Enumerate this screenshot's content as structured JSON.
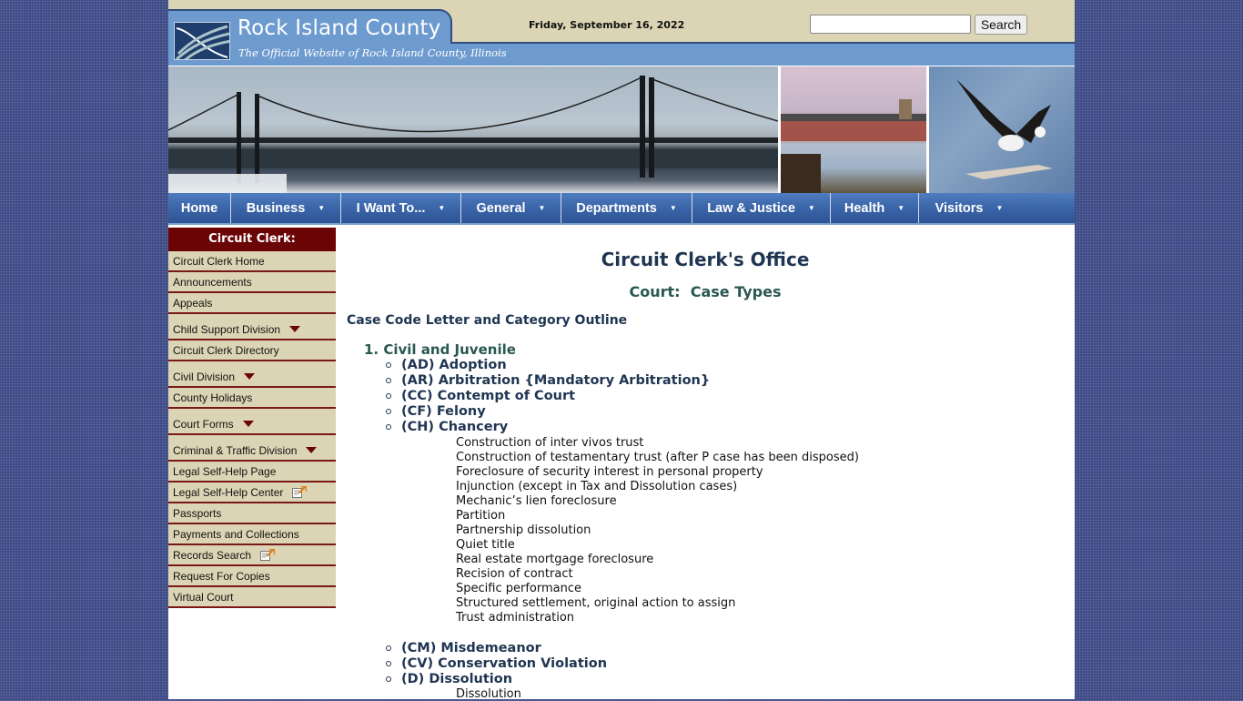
{
  "header": {
    "site_title": "Rock Island County",
    "site_subtitle": "The Official Website of Rock Island County, Illinois",
    "date": "Friday, September 16, 2022",
    "search": {
      "placeholder": "",
      "value": "",
      "button_label": "Search"
    }
  },
  "banner": {
    "images": [
      "bridge-photo",
      "lock-and-dam-photo",
      "bald-eagle-photo"
    ]
  },
  "nav": {
    "items": [
      {
        "label": "Home",
        "has_dropdown": false
      },
      {
        "label": "Business",
        "has_dropdown": true
      },
      {
        "label": "I Want To...",
        "has_dropdown": true
      },
      {
        "label": "General",
        "has_dropdown": true
      },
      {
        "label": "Departments",
        "has_dropdown": true
      },
      {
        "label": "Law & Justice",
        "has_dropdown": true
      },
      {
        "label": "Health",
        "has_dropdown": true
      },
      {
        "label": "Visitors",
        "has_dropdown": true
      }
    ]
  },
  "sidebar": {
    "heading": "Circuit Clerk:",
    "items": [
      {
        "label": "Circuit Clerk Home",
        "icon": ""
      },
      {
        "label": "Announcements",
        "icon": ""
      },
      {
        "label": "Appeals",
        "icon": ""
      },
      {
        "label": "Child Support Division",
        "icon": "dropdown-arrow"
      },
      {
        "label": "Circuit Clerk Directory",
        "icon": ""
      },
      {
        "label": "Civil Division",
        "icon": "dropdown-arrow"
      },
      {
        "label": "County Holidays",
        "icon": ""
      },
      {
        "label": "Court Forms",
        "icon": "dropdown-arrow"
      },
      {
        "label": "Criminal & Traffic Division",
        "icon": "dropdown-arrow"
      },
      {
        "label": "Legal Self-Help Page",
        "icon": ""
      },
      {
        "label": "Legal Self-Help Center",
        "icon": "external-link"
      },
      {
        "label": "Passports",
        "icon": ""
      },
      {
        "label": "Payments and Collections",
        "icon": ""
      },
      {
        "label": "Records Search",
        "icon": "external-link"
      },
      {
        "label": "Request For Copies",
        "icon": ""
      },
      {
        "label": "Virtual Court",
        "icon": ""
      }
    ]
  },
  "content": {
    "title": "Circuit Clerk's Office",
    "subtitle": "Court:  Case Types",
    "outline_heading": "Case Code Letter and Category Outline",
    "section": "1. Civil and Juvenile",
    "categories": [
      {
        "label": "(AD) Adoption",
        "subitems": []
      },
      {
        "label": "(AR) Arbitration {Mandatory Arbitration}",
        "subitems": []
      },
      {
        "label": "(CC) Contempt of Court",
        "subitems": []
      },
      {
        "label": "(CF) Felony",
        "subitems": []
      },
      {
        "label": "(CH) Chancery",
        "subitems": [
          "Construction of inter vivos trust",
          "Construction of testamentary trust (after P case has been disposed)",
          "Foreclosure of security interest in personal property",
          "Injunction (except in Tax and Dissolution cases)",
          "Mechanic’s lien foreclosure",
          "Partition",
          "Partnership dissolution",
          "Quiet title",
          "Real estate mortgage foreclosure",
          "Recision of contract",
          "Specific performance",
          "Structured settlement, original action to assign",
          "Trust administration"
        ]
      },
      {
        "label": "(CM) Misdemeanor",
        "subitems": []
      },
      {
        "label": "(CV) Conservation Violation",
        "subitems": []
      },
      {
        "label": "(D) Dissolution",
        "subitems": [
          "Dissolution"
        ]
      }
    ]
  }
}
